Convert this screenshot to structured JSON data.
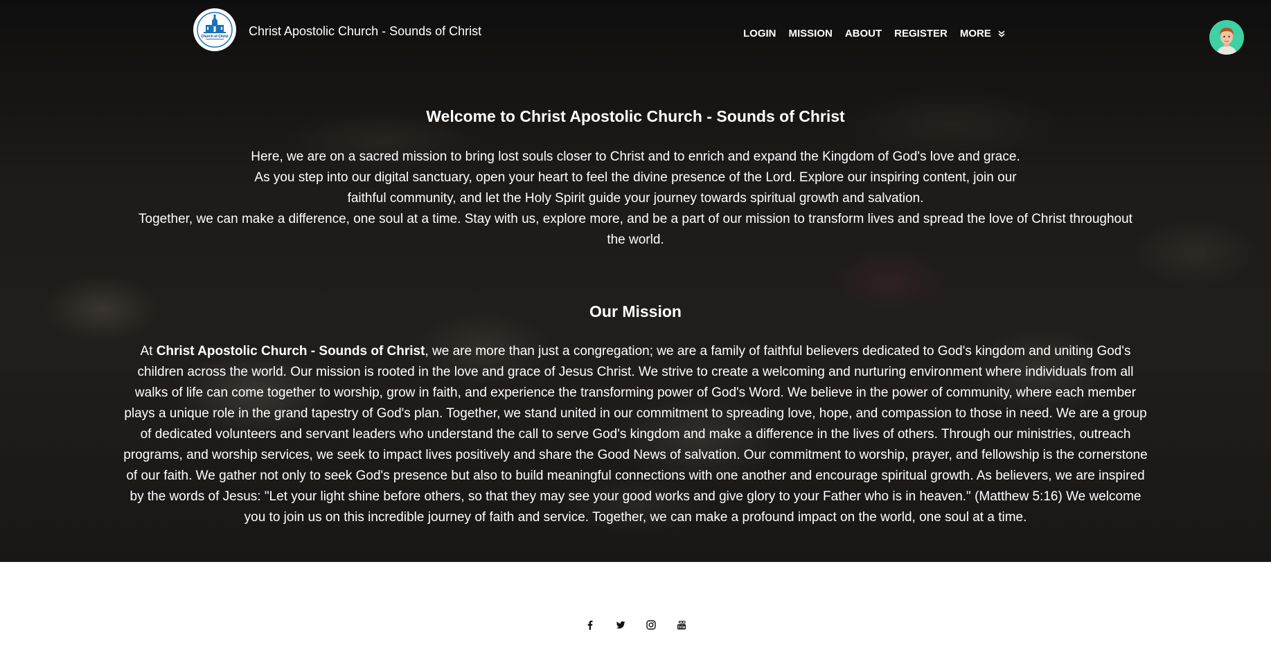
{
  "header": {
    "site_title": "Christ Apostolic Church - Sounds of Christ",
    "logo_text": "Church of Christ",
    "nav": [
      {
        "label": "LOGIN"
      },
      {
        "label": "MISSION"
      },
      {
        "label": "ABOUT"
      },
      {
        "label": "REGISTER"
      },
      {
        "label": "MORE"
      }
    ]
  },
  "welcome": {
    "title": "Welcome to Christ Apostolic Church - Sounds of Christ",
    "paragraph1": "Here, we are on a sacred mission to bring lost souls closer to Christ and to enrich and expand the Kingdom of God's love and grace. As you step into our digital sanctuary, open your heart to feel the divine presence of the Lord. Explore our inspiring content, join our faithful community, and let the Holy Spirit guide your journey towards spiritual growth and salvation.",
    "paragraph2": "Together, we can make a difference, one soul at a time. Stay with us, explore more, and be a part of our mission to transform lives and spread the love of Christ throughout the world."
  },
  "mission": {
    "title": "Our Mission",
    "intro_prefix": "At ",
    "church_name": "Christ Apostolic Church - Sounds of Christ",
    "body": ", we are more than just a congregation; we are a family of faithful believers dedicated to God's kingdom and uniting God's children across the world. Our mission is rooted in the love and grace of Jesus Christ. We strive to create a welcoming and nurturing environment where individuals from all walks of life can come together to worship, grow in faith, and experience the transforming power of God's Word. We believe in the power of community, where each member plays a unique role in the grand tapestry of God's plan. Together, we stand united in our commitment to spreading love, hope, and compassion to those in need. We are a group of dedicated volunteers and servant leaders who understand the call to serve God's kingdom and make a difference in the lives of others. Through our ministries, outreach programs, and worship services, we seek to impact lives positively and share the Good News of salvation. Our commitment to worship, prayer, and fellowship is the cornerstone of our faith. We gather not only to seek God's presence but also to build meaningful connections with one another and encourage spiritual growth. As believers, we are inspired by the words of Jesus: \"Let your light shine before others, so that they may see your good works and give glory to your Father who is in heaven.\" (Matthew 5:16) We welcome you to join us on this incredible journey of faith and service. Together, we can make a profound impact on the world, one soul at a time."
  },
  "footer": {
    "socials": [
      "facebook-icon",
      "twitter-icon",
      "instagram-icon",
      "youtube-icon"
    ]
  },
  "colors": {
    "text_on_hero": "#ffffff",
    "avatar_bg": "#3fd1a3",
    "logo_blue": "#1a73b8",
    "footer_bg": "#ffffff"
  }
}
